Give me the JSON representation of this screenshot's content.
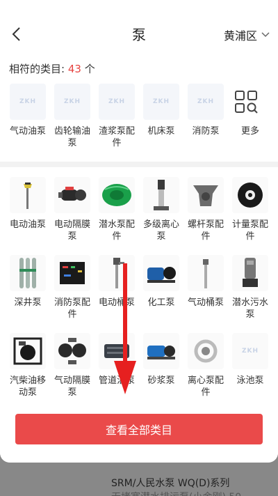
{
  "header": {
    "title": "泵",
    "district": "黄浦区"
  },
  "match": {
    "label": "相符的类目:",
    "count": "43",
    "unit": "个"
  },
  "placeholder_text": "ZKH",
  "top_categories": [
    {
      "label": "气动油泵"
    },
    {
      "label": "齿轮输油泵"
    },
    {
      "label": "渣浆泵配件"
    },
    {
      "label": "机床泵"
    },
    {
      "label": "消防泵"
    },
    {
      "label": "更多"
    }
  ],
  "grid_categories": [
    {
      "label": "电动油泵"
    },
    {
      "label": "电动隔膜泵"
    },
    {
      "label": "潜水泵配件"
    },
    {
      "label": "多级离心泵"
    },
    {
      "label": "螺杆泵配件"
    },
    {
      "label": "计量泵配件"
    },
    {
      "label": "深井泵"
    },
    {
      "label": "消防泵配件"
    },
    {
      "label": "电动桶泵"
    },
    {
      "label": "化工泵"
    },
    {
      "label": "气动桶泵"
    },
    {
      "label": "潜水污水泵"
    },
    {
      "label": "汽柴油移动泵"
    },
    {
      "label": "气动隔膜泵"
    },
    {
      "label": "管道油泵"
    },
    {
      "label": "砂浆泵"
    },
    {
      "label": "离心泵配件"
    },
    {
      "label": "泳池泵"
    }
  ],
  "view_all_button": "查看全部类目",
  "background_product": {
    "line1": "SRM/人民水泵 WQ(D)系列",
    "line2": "无堵塞潜水排污泵(小金刚) 50"
  },
  "colors": {
    "accent_red": "#e64340",
    "button_red": "#ea4a4a",
    "arrow_red": "#e62020"
  }
}
